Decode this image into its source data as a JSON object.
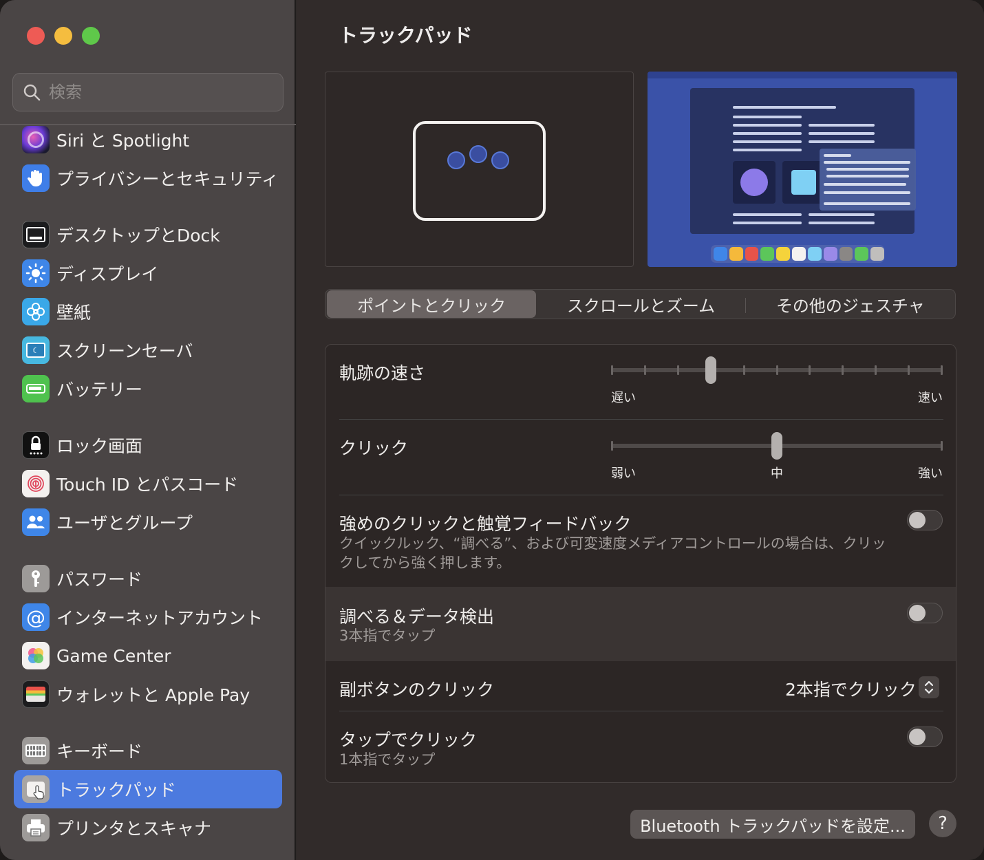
{
  "search": {
    "placeholder": "検索"
  },
  "sidebar": {
    "items": [
      {
        "label": "Siri と Spotlight",
        "icon": "siri-icon"
      },
      {
        "label": "プライバシーとセキュリティ",
        "icon": "hand-icon"
      },
      {
        "label": "デスクトップとDock",
        "icon": "dock-icon"
      },
      {
        "label": "ディスプレイ",
        "icon": "sun-icon"
      },
      {
        "label": "壁紙",
        "icon": "flower-icon"
      },
      {
        "label": "スクリーンセーバ",
        "icon": "screensaver-icon"
      },
      {
        "label": "バッテリー",
        "icon": "battery-icon"
      },
      {
        "label": "ロック画面",
        "icon": "lock-icon"
      },
      {
        "label": "Touch ID とパスコード",
        "icon": "fingerprint-icon"
      },
      {
        "label": "ユーザとグループ",
        "icon": "users-icon"
      },
      {
        "label": "パスワード",
        "icon": "key-icon"
      },
      {
        "label": "インターネットアカウント",
        "icon": "at-icon"
      },
      {
        "label": "Game Center",
        "icon": "game-center-icon"
      },
      {
        "label": "ウォレットと Apple Pay",
        "icon": "wallet-icon"
      },
      {
        "label": "キーボード",
        "icon": "keyboard-icon"
      },
      {
        "label": "トラックパッド",
        "icon": "trackpad-icon",
        "selected": true
      },
      {
        "label": "プリンタとスキャナ",
        "icon": "printer-icon"
      }
    ]
  },
  "main": {
    "title": "トラックパッド",
    "tabs": [
      {
        "label": "ポイントとクリック",
        "active": true
      },
      {
        "label": "スクロールとズーム"
      },
      {
        "label": "その他のジェスチャ"
      }
    ],
    "tracking_speed": {
      "title": "軌跡の速さ",
      "min_label": "遅い",
      "max_label": "速い",
      "value_step": 3,
      "steps": 10
    },
    "click": {
      "title": "クリック",
      "min_label": "弱い",
      "mid_label": "中",
      "max_label": "強い",
      "value_step": 1,
      "steps": 2
    },
    "force_click": {
      "title": "強めのクリックと触覚フィードバック",
      "description": "クイックルック、“調べる”、および可変速度メディアコントロールの場合は、クリックしてから強く押します。",
      "enabled": false
    },
    "lookup": {
      "title": "調べる＆データ検出",
      "subtitle": "3本指でタップ",
      "enabled": false
    },
    "secondary_click": {
      "title": "副ボタンのクリック",
      "value": "2本指でクリック"
    },
    "tap_to_click": {
      "title": "タップでクリック",
      "subtitle": "1本指でタップ",
      "enabled": false
    },
    "bluetooth_button": "Bluetooth トラックパッドを設定...",
    "help_button": "?"
  },
  "colors": {
    "accent": "#4c7adf",
    "sidebar_bg": "#4a4545",
    "main_bg": "#312b2a"
  }
}
